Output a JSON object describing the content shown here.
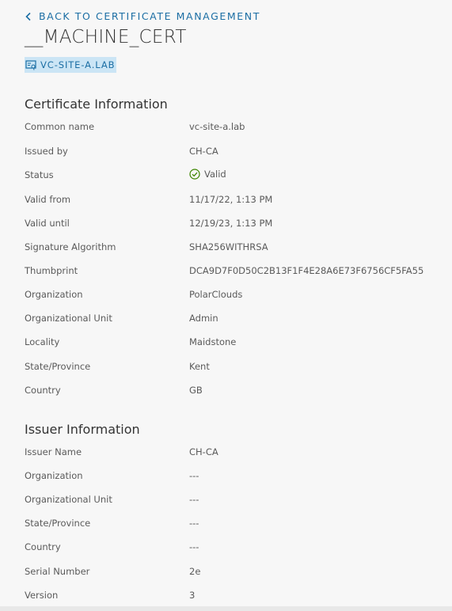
{
  "nav": {
    "back_label": "BACK TO CERTIFICATE MANAGEMENT"
  },
  "header": {
    "title": "__MACHINE_CERT",
    "host_label": "VC-SITE-A.LAB"
  },
  "certificate_info": {
    "title": "Certificate Information",
    "rows": [
      {
        "label": "Common name",
        "value": "vc-site-a.lab"
      },
      {
        "label": "Issued by",
        "value": "CH-CA"
      },
      {
        "label": "Status",
        "value": "Valid"
      },
      {
        "label": "Valid from",
        "value": "11/17/22, 1:13 PM"
      },
      {
        "label": "Valid until",
        "value": "12/19/23, 1:13 PM"
      },
      {
        "label": "Signature Algorithm",
        "value": "SHA256WITHRSA"
      },
      {
        "label": "Thumbprint",
        "value": "DCA9D7F0D50C2B13F1F4E28A6E73F6756CF5FA55"
      },
      {
        "label": "Organization",
        "value": "PolarClouds"
      },
      {
        "label": "Organizational Unit",
        "value": "Admin"
      },
      {
        "label": "Locality",
        "value": "Maidstone"
      },
      {
        "label": "State/Province",
        "value": "Kent"
      },
      {
        "label": "Country",
        "value": "GB"
      }
    ]
  },
  "issuer_info": {
    "title": "Issuer Information",
    "rows": [
      {
        "label": "Issuer Name",
        "value": "CH-CA"
      },
      {
        "label": "Organization",
        "value": "---"
      },
      {
        "label": "Organizational Unit",
        "value": "---"
      },
      {
        "label": "State/Province",
        "value": "---"
      },
      {
        "label": "Country",
        "value": "---"
      },
      {
        "label": "Serial Number",
        "value": "2e"
      },
      {
        "label": "Version",
        "value": "3"
      }
    ]
  },
  "colors": {
    "link": "#1b6ea4",
    "chip_bg": "#cbe5f5",
    "valid_green": "#3c8500"
  },
  "icons": {
    "back": "chevron-left-icon",
    "host": "host-icon",
    "status_valid": "check-circle-icon"
  }
}
